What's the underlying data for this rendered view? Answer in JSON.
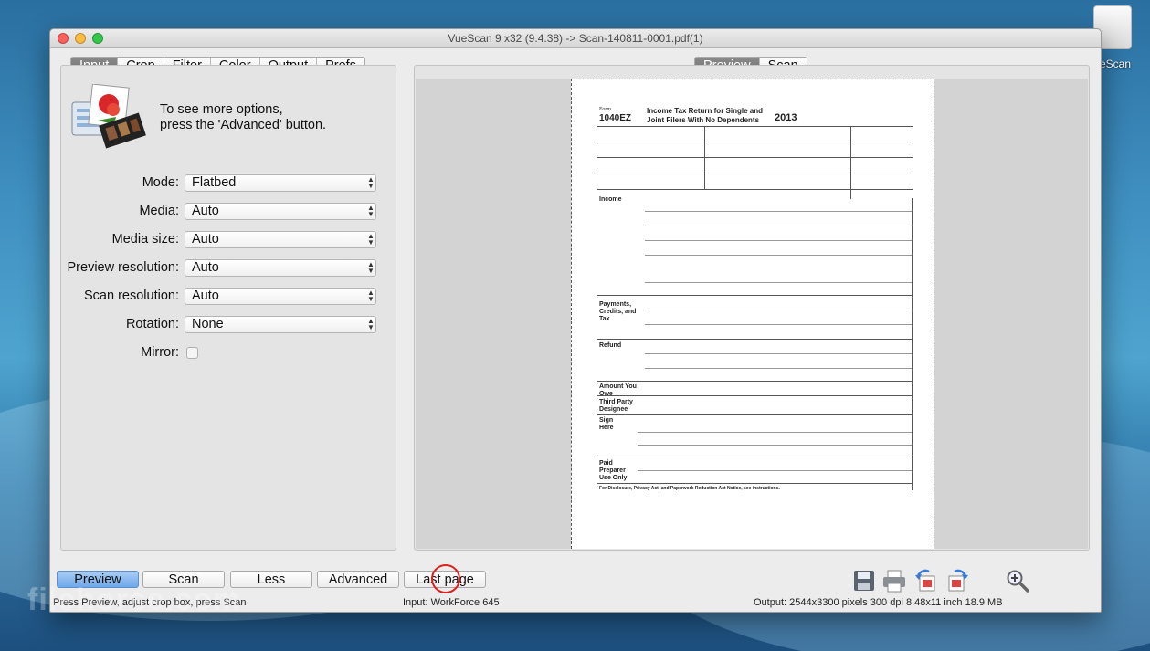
{
  "desktop": {
    "icon_label": "eScan"
  },
  "window": {
    "title": "VueScan 9 x32 (9.4.38) -> Scan-140811-0001.pdf(1)"
  },
  "left_tabs": [
    "Input",
    "Crop",
    "Filter",
    "Color",
    "Output",
    "Prefs"
  ],
  "right_tabs": [
    "Preview",
    "Scan"
  ],
  "hint": {
    "line1": "To see more options,",
    "line2": "press the 'Advanced' button."
  },
  "form": {
    "mode_label": "Mode:",
    "mode_value": "Flatbed",
    "media_label": "Media:",
    "media_value": "Auto",
    "media_size_label": "Media size:",
    "media_size_value": "Auto",
    "preview_res_label": "Preview resolution:",
    "preview_res_value": "Auto",
    "scan_res_label": "Scan resolution:",
    "scan_res_value": "Auto",
    "rotation_label": "Rotation:",
    "rotation_value": "None",
    "mirror_label": "Mirror:"
  },
  "buttons": {
    "preview": "Preview",
    "scan": "Scan",
    "less": "Less",
    "advanced": "Advanced",
    "last_page": "Last page"
  },
  "status": {
    "left": "Press Preview, adjust crop box, press Scan",
    "middle": "Input: WorkForce 645",
    "right": "Output: 2544x3300 pixels 300 dpi 8.48x11 inch 18.9 MB"
  },
  "document": {
    "form_no": "1040EZ",
    "form_tag": "Form",
    "title_line1": "Income Tax Return for Single and",
    "title_line2": "Joint Filers With No Dependents",
    "year": "2013",
    "sections": [
      "Income",
      "Payments, Credits, and Tax",
      "Refund",
      "Amount You Owe",
      "Third Party Designee",
      "Sign Here",
      "Paid Preparer Use Only"
    ],
    "footer": "For Disclosure, Privacy Act, and Paperwork Reduction Act Notice, see instructions."
  },
  "watermark": "filehorse.com",
  "colors": {
    "accent": "#6ea8ea",
    "active_tab": "#7a7a7a"
  }
}
